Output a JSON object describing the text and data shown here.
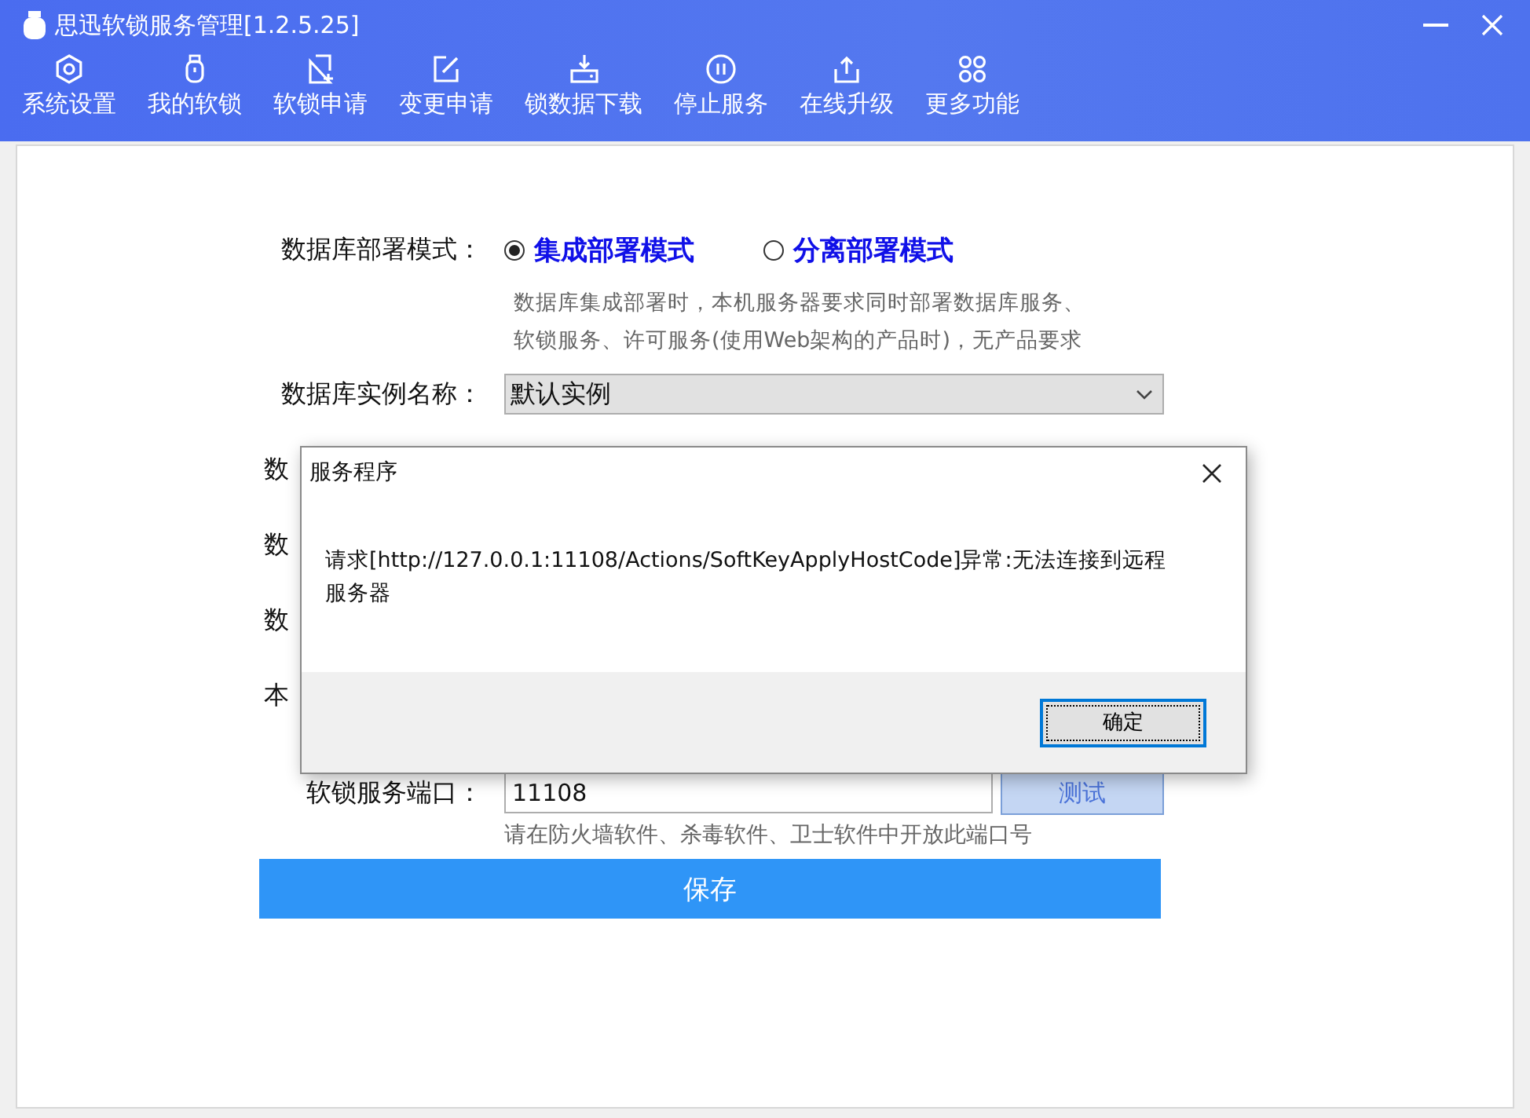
{
  "window": {
    "title": "思迅软锁服务管理[1.2.5.25]"
  },
  "toolbar": [
    {
      "label": "系统设置",
      "kind": "gear"
    },
    {
      "label": "我的软锁",
      "kind": "usb"
    },
    {
      "label": "软锁申请",
      "kind": "docadd"
    },
    {
      "label": "变更申请",
      "kind": "edit"
    },
    {
      "label": "锁数据下载",
      "kind": "download"
    },
    {
      "label": "停止服务",
      "kind": "pause"
    },
    {
      "label": "在线升级",
      "kind": "upload"
    },
    {
      "label": "更多功能",
      "kind": "more"
    }
  ],
  "form": {
    "deploy_mode": {
      "label": "数据库部署模式：",
      "options": [
        {
          "label": "集成部署模式",
          "selected": true
        },
        {
          "label": "分离部署模式",
          "selected": false
        }
      ],
      "description": [
        "数据库集成部署时，本机服务器要求同时部署数据库服务、",
        "软锁服务、许可服务(使用Web架构的产品时)，无产品要求"
      ]
    },
    "instance": {
      "label": "数据库实例名称：",
      "value": "默认实例"
    },
    "covered_rows": [
      {
        "label": "数"
      },
      {
        "label": "数"
      },
      {
        "label": "数"
      },
      {
        "label": "本"
      }
    ],
    "port": {
      "label": "软锁服务端口：",
      "value": "11108",
      "button": "测试"
    },
    "hint": "请在防火墙软件、杀毒软件、卫士软件中开放此端口号",
    "save": "保存"
  },
  "dialog": {
    "title": "服务程序",
    "message": "请求[http://127.0.0.1:11108/Actions/SoftKeyApplyHostCode]异常:无法连接到远程服务器",
    "ok": "确定"
  }
}
